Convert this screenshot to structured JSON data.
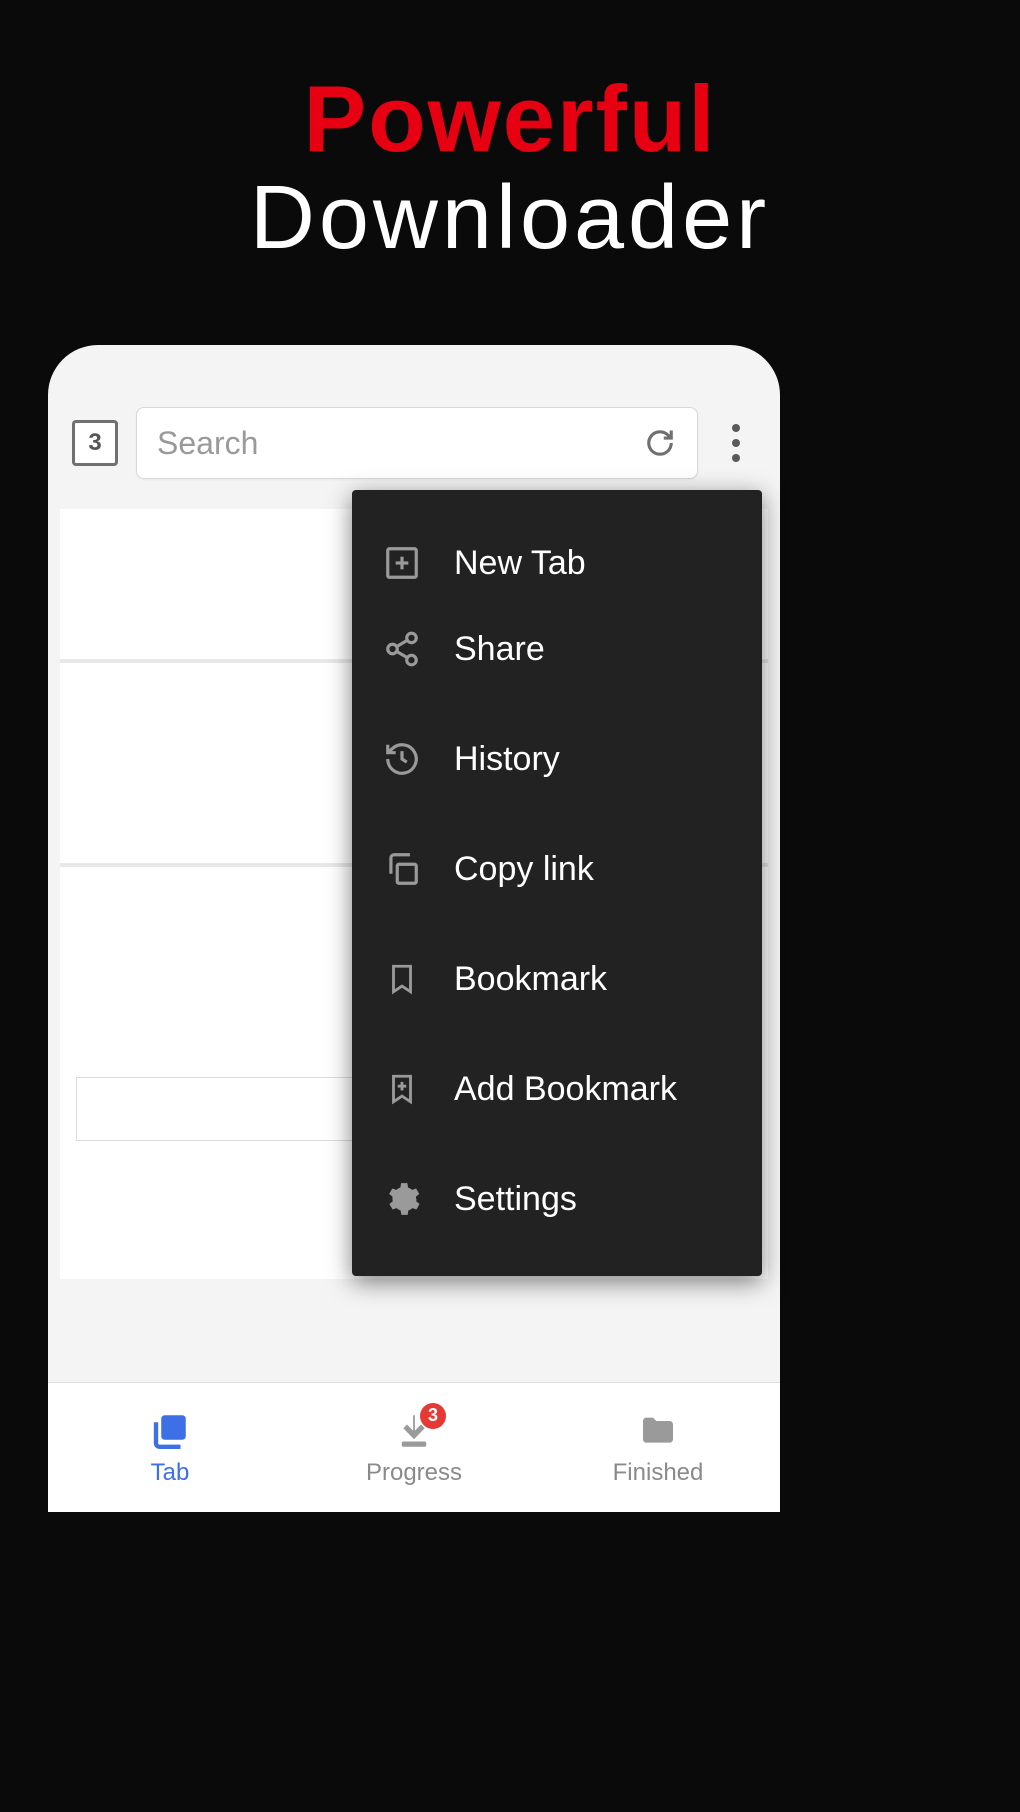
{
  "hero": {
    "line1": "Powerful",
    "line2": "Downloader"
  },
  "topbar": {
    "tab_count": "3",
    "search_placeholder": "Search"
  },
  "menu": {
    "items": [
      {
        "icon": "plus-box-icon",
        "label": "New Tab"
      },
      {
        "icon": "share-icon",
        "label": "Share"
      },
      {
        "icon": "history-icon",
        "label": "History"
      },
      {
        "icon": "copy-icon",
        "label": "Copy link"
      },
      {
        "icon": "bookmark-icon",
        "label": "Bookmark"
      },
      {
        "icon": "add-bookmark-icon",
        "label": "Add Bookmark"
      },
      {
        "icon": "settings-icon",
        "label": "Settings"
      }
    ]
  },
  "bottom_nav": {
    "items": [
      {
        "label": "Tab",
        "active": true
      },
      {
        "label": "Progress",
        "badge": "3"
      },
      {
        "label": "Finished"
      }
    ]
  }
}
